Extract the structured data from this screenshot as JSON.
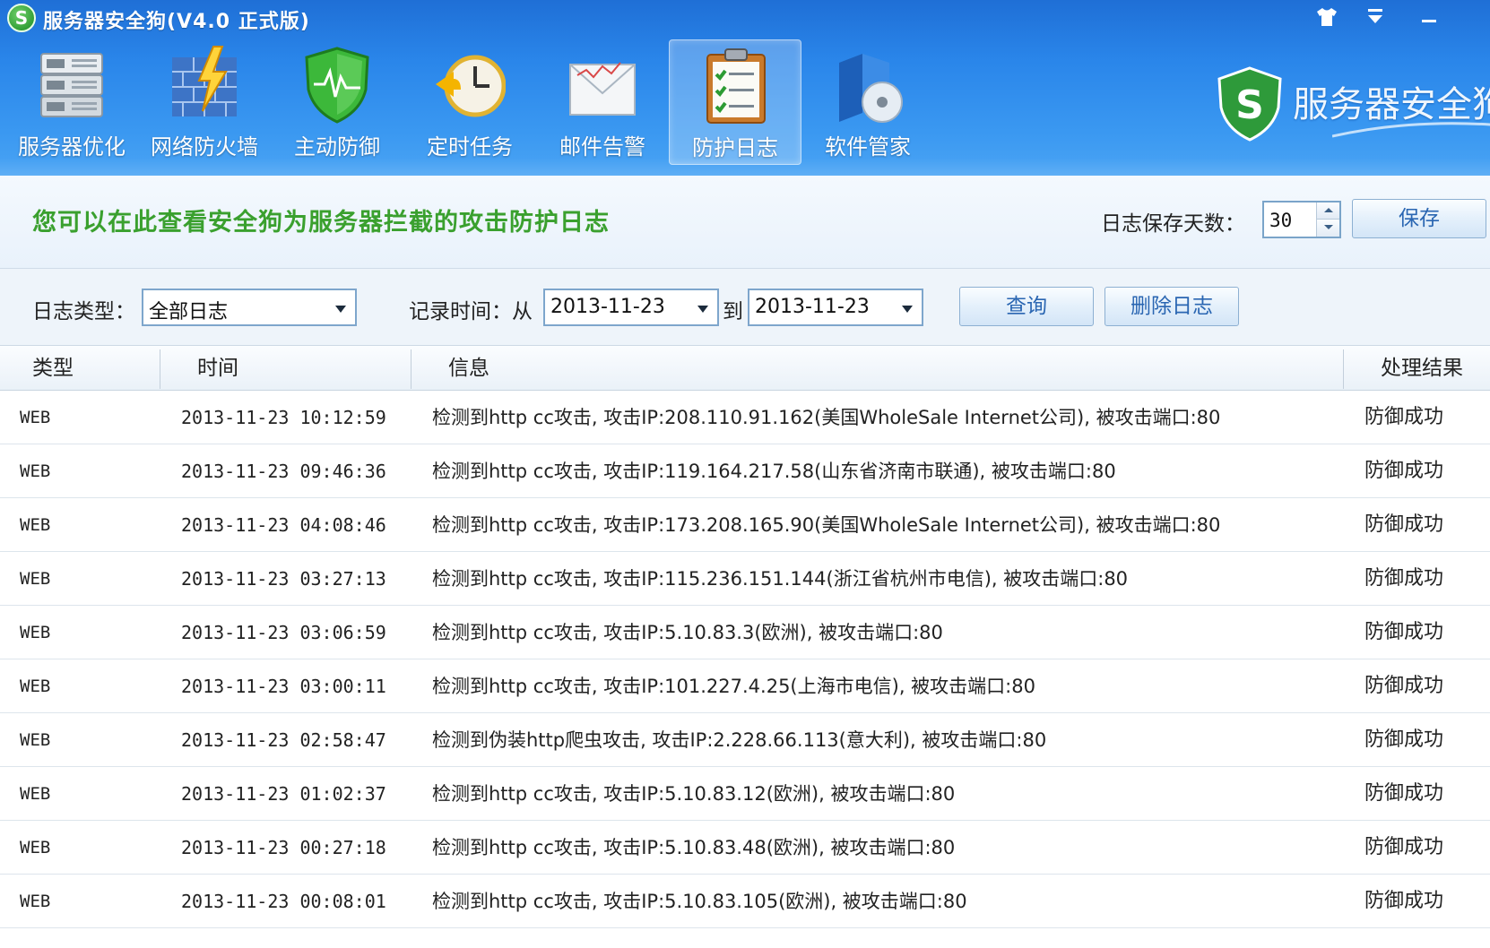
{
  "window": {
    "title": "服务器安全狗(V4.0 正式版)",
    "logo_letter": "S",
    "brand_text": "服务器安全狗"
  },
  "toolbar": [
    {
      "label": "服务器优化",
      "icon": "server-icon"
    },
    {
      "label": "网络防火墙",
      "icon": "firewall-icon"
    },
    {
      "label": "主动防御",
      "icon": "shield-icon"
    },
    {
      "label": "定时任务",
      "icon": "clock-icon"
    },
    {
      "label": "邮件告警",
      "icon": "mail-icon"
    },
    {
      "label": "防护日志",
      "icon": "clipboard-icon",
      "active": true
    },
    {
      "label": "软件管家",
      "icon": "software-box-icon"
    }
  ],
  "intro": {
    "text": "您可以在此查看安全狗为服务器拦截的攻击防护日志",
    "days_label": "日志保存天数：",
    "days_value": "30",
    "save_label": "保存"
  },
  "filter": {
    "type_label": "日志类型：",
    "type_value": "全部日志",
    "time_label": "记录时间：从",
    "from_date": "2013-11-23",
    "to_label": "到",
    "to_date": "2013-11-23",
    "query_label": "查询",
    "delete_label": "删除日志"
  },
  "table": {
    "columns": [
      "类型",
      "时间",
      "信息",
      "处理结果"
    ],
    "rows": [
      {
        "type": "WEB",
        "time": "2013-11-23 10:12:59",
        "info": "检测到http cc攻击, 攻击IP:208.110.91.162(美国WholeSale Internet公司), 被攻击端口:80",
        "result": "防御成功"
      },
      {
        "type": "WEB",
        "time": "2013-11-23 09:46:36",
        "info": "检测到http cc攻击, 攻击IP:119.164.217.58(山东省济南市联通), 被攻击端口:80",
        "result": "防御成功"
      },
      {
        "type": "WEB",
        "time": "2013-11-23 04:08:46",
        "info": "检测到http cc攻击, 攻击IP:173.208.165.90(美国WholeSale Internet公司), 被攻击端口:80",
        "result": "防御成功"
      },
      {
        "type": "WEB",
        "time": "2013-11-23 03:27:13",
        "info": "检测到http cc攻击, 攻击IP:115.236.151.144(浙江省杭州市电信), 被攻击端口:80",
        "result": "防御成功"
      },
      {
        "type": "WEB",
        "time": "2013-11-23 03:06:59",
        "info": "检测到http cc攻击, 攻击IP:5.10.83.3(欧洲), 被攻击端口:80",
        "result": "防御成功"
      },
      {
        "type": "WEB",
        "time": "2013-11-23 03:00:11",
        "info": "检测到http cc攻击, 攻击IP:101.227.4.25(上海市电信), 被攻击端口:80",
        "result": "防御成功"
      },
      {
        "type": "WEB",
        "time": "2013-11-23 02:58:47",
        "info": "检测到伪装http爬虫攻击, 攻击IP:2.228.66.113(意大利), 被攻击端口:80",
        "result": "防御成功"
      },
      {
        "type": "WEB",
        "time": "2013-11-23 01:02:37",
        "info": "检测到http cc攻击, 攻击IP:5.10.83.12(欧洲), 被攻击端口:80",
        "result": "防御成功"
      },
      {
        "type": "WEB",
        "time": "2013-11-23 00:27:18",
        "info": "检测到http cc攻击, 攻击IP:5.10.83.48(欧洲), 被攻击端口:80",
        "result": "防御成功"
      },
      {
        "type": "WEB",
        "time": "2013-11-23 00:08:01",
        "info": "检测到http cc攻击, 攻击IP:5.10.83.105(欧洲), 被攻击端口:80",
        "result": "防御成功"
      }
    ]
  },
  "colors": {
    "header_blue": "#2a86ea",
    "intro_green": "#3aa02e",
    "button_text": "#2a66b2"
  }
}
